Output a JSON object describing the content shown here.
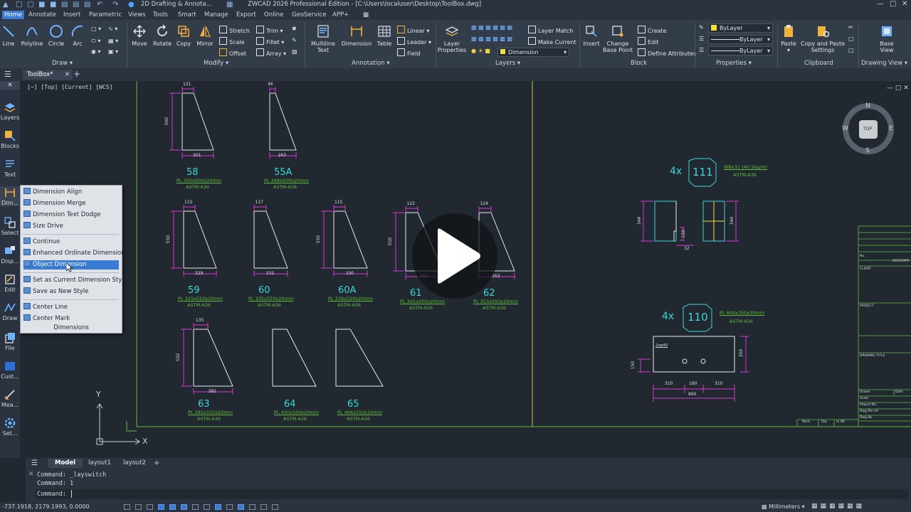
{
  "titlebar": {
    "workspace": "2D Drafting & Annota...",
    "title": "ZWCAD 2026 Professional Edition - [C:\\Users\\localuser\\Desktop\\ToolBox.dwg]"
  },
  "menu": [
    "Home",
    "Annotate",
    "Insert",
    "Parametric",
    "Views",
    "Tools",
    "Smart",
    "Manage",
    "Export",
    "Online",
    "GeoService",
    "APP+"
  ],
  "ribbon": {
    "draw": {
      "line": "Line",
      "polyline": "Polyline",
      "circle": "Circle",
      "arc": "Arc",
      "label": "Draw"
    },
    "modify": {
      "move": "Move",
      "rotate": "Rotate",
      "copy": "Copy",
      "mirror": "Mirror",
      "stretch": "Stretch",
      "scale": "Scale",
      "offset": "Offset",
      "trim": "Trim",
      "fillet": "Fillet",
      "array": "Array",
      "label": "Modify"
    },
    "annotation": {
      "mtext_1": "Multiline",
      "mtext_2": "Text",
      "dimension": "Dimension",
      "table": "Table",
      "linear": "Linear",
      "leader": "Leader",
      "field": "Field",
      "label": "Annotation"
    },
    "layers": {
      "props_1": "Layer",
      "props_2": "Properties",
      "match": "Layer Match",
      "current": "Make Current",
      "layer_value": "Dimension",
      "label": "Layers"
    },
    "block": {
      "insert": "Insert",
      "cbp_1": "Change",
      "cbp_2": "Base Point",
      "create": "Create",
      "edit": "Edit",
      "define": "Define Attributes",
      "label": "Block"
    },
    "properties": {
      "color": "ByLayer",
      "linetype": "ByLayer",
      "lineweight": "ByLayer",
      "label": "Properties"
    },
    "clipboard": {
      "paste": "Paste",
      "cps_1": "Copy and Paste",
      "cps_2": "Settings",
      "label": "Clipboard"
    },
    "drawingview": {
      "bv_1": "Base",
      "bv_2": "View",
      "label": "Drawing View"
    }
  },
  "doc_tab": "ToolBox*",
  "palette": [
    "Layers",
    "Blocks",
    "Text",
    "Dim...",
    "Select",
    "Disp...",
    "Edit",
    "Draw",
    "File",
    "Cust...",
    "Mea...",
    "Set..."
  ],
  "viewport_label": "[−] [Top] [Current] [WCS]",
  "popup": {
    "items": [
      "Dimension Align",
      "Dimension Merge",
      "Dimension Text Dodge",
      "Size Drive",
      "Continue",
      "Enhanced Ordinate Dimension",
      "Object Dimension",
      "Set as Current Dimension Style",
      "Save as New Style",
      "Center Line",
      "Center Mark"
    ],
    "footer": "Dimensions"
  },
  "viewcube": {
    "n": "N",
    "s": "S",
    "e": "E",
    "w": "W",
    "top": "TOP"
  },
  "drawing": {
    "parts_row1": [
      {
        "num": "58",
        "spec": "PL 300x500x20mm",
        "mat": "ASTM-A36",
        "top": "121",
        "side": "500",
        "bottom": "301"
      },
      {
        "num": "55A",
        "spec": "PL 268x500x20mm",
        "mat": "ASTM-A36",
        "top": "46",
        "side": "",
        "bottom": "263"
      }
    ],
    "parts_row2": [
      {
        "num": "59",
        "spec": "PL 325x550x20mm",
        "mat": "ASTM-A36",
        "top": "115",
        "side": "550",
        "bottom": "329"
      },
      {
        "num": "60",
        "spec": "PL 335x550x20mm",
        "mat": "ASTM-A36",
        "top": "117",
        "side": "",
        "bottom": "332"
      },
      {
        "num": "60A",
        "spec": "PL 339x550x20mm",
        "mat": "ASTM-A36",
        "top": "115",
        "side": "550",
        "bottom": "330"
      },
      {
        "num": "61",
        "spec": "PL 345x550x20mm",
        "mat": "ASTM-A36",
        "top": "122",
        "side": "550",
        "bottom": "345"
      },
      {
        "num": "62",
        "spec": "PL 353x550x20mm",
        "mat": "ASTM-A36",
        "top": "124",
        "side": "",
        "bottom": "353"
      }
    ],
    "parts_row3": [
      {
        "num": "63",
        "spec": "PL 382x550x20mm",
        "mat": "ASTM-A36",
        "top": "135",
        "side": "550",
        "bottom": "382"
      },
      {
        "num": "64",
        "spec": "PL 430x550x20mm",
        "mat": "ASTM-A36"
      },
      {
        "num": "65",
        "spec": "PL 466x550x20mm",
        "mat": "ASTM-A36"
      }
    ],
    "detail111": {
      "qty": "4x",
      "num": "111",
      "spec": "WBx31 (40.1kg/m)",
      "mat": "ASTM-A36",
      "h1": "344",
      "h2": "150",
      "w": "32",
      "h3": "344"
    },
    "detail110": {
      "qty": "4x",
      "num": "110",
      "spec": "PL 600x350x30mm",
      "mat": "ASTM-A36",
      "hole": "2xø40",
      "d1": "310",
      "d2": "180",
      "d3": "310",
      "total": "860",
      "h": "350",
      "side": "150"
    },
    "titleblock": [
      "No.",
      "DESCRIPTI",
      "CLIENT",
      "PROJECT",
      "DRAWING TITLE",
      "Drawn",
      "Date",
      "Scale",
      "Project No.",
      "Dwg file ref",
      "Dwg.No",
      "Mark",
      "Qty",
      "m Wt"
    ]
  },
  "layout_tabs": [
    "Model",
    "layout1",
    "layout2",
    "+"
  ],
  "command": [
    "Command: _layswitch",
    "Command: 1",
    "Command:"
  ],
  "status": {
    "coords": "-737.1918, 2179.1993, 0.0000",
    "units": "Millimeters"
  },
  "axis": {
    "x": "X",
    "y": "Y"
  }
}
